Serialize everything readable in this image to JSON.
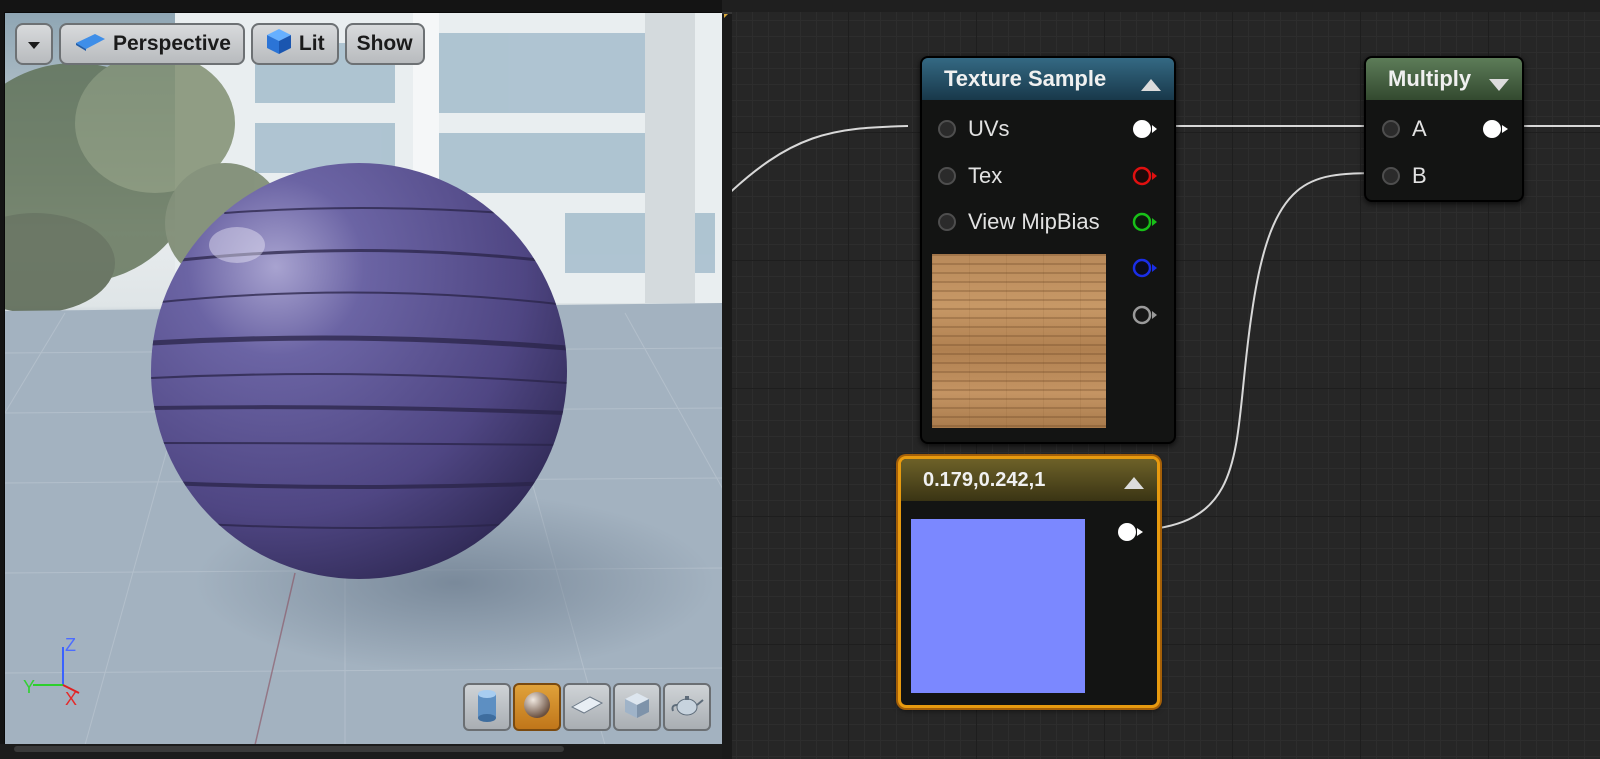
{
  "viewport": {
    "toolbar": {
      "dropdown_icon": "caret-down-icon",
      "perspective_label": "Perspective",
      "lit_label": "Lit",
      "show_label": "Show"
    },
    "axes": {
      "z": "Z",
      "y": "Y",
      "x": "X"
    },
    "preview_meshes": [
      "cylinder-icon",
      "sphere-icon",
      "plane-icon",
      "cube-icon",
      "teapot-icon"
    ],
    "active_mesh": "sphere-icon"
  },
  "graph": {
    "texture_sample": {
      "title": "Texture Sample",
      "inputs": [
        "UVs",
        "Tex",
        "View MipBias"
      ],
      "output_colors": [
        "#ffffff",
        "#e01010",
        "#18c018",
        "#1a2ee8",
        "#9a9a9a"
      ]
    },
    "multiply": {
      "title": "Multiply",
      "inputs": [
        "A",
        "B"
      ]
    },
    "constant": {
      "title": "0.179,0.242,1",
      "color": "#7b88ff"
    }
  },
  "colors": {
    "selection": "#e79a0f",
    "sphere": "#5a4f8a",
    "wire": "#d8d8d8"
  }
}
